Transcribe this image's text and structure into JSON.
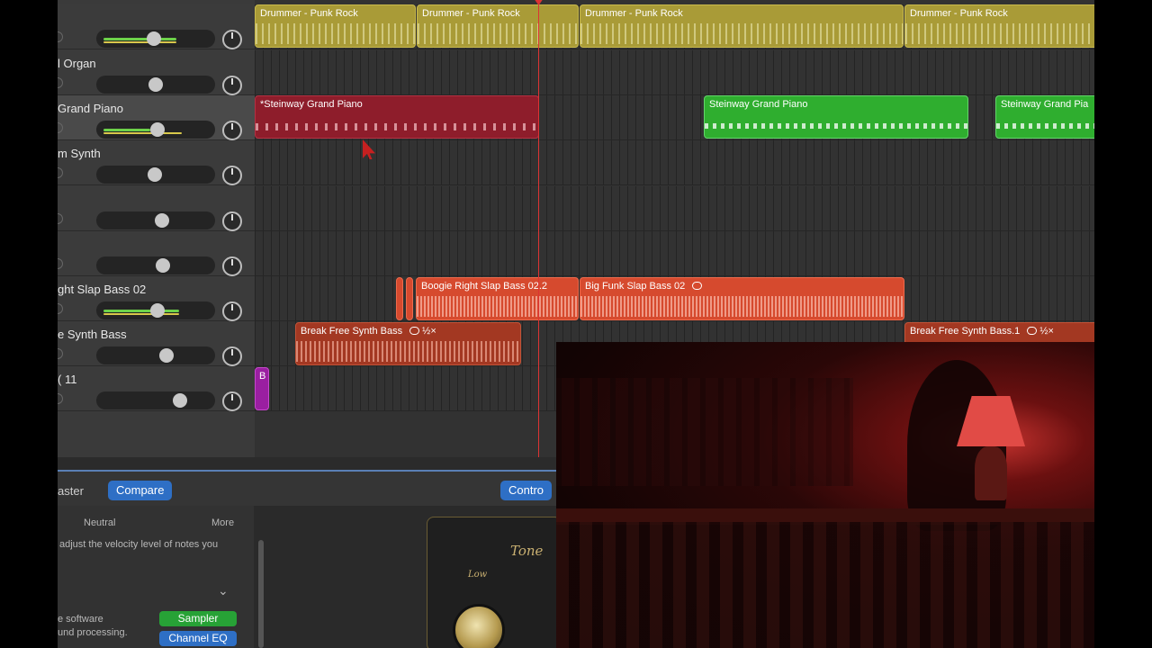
{
  "tracks": [
    {
      "name": "",
      "fader_level": 0.48,
      "meter": 0.7,
      "meter2": 0.7
    },
    {
      "name": "l Organ",
      "fader_level": 0.5,
      "meter": 0,
      "meter2": 0
    },
    {
      "name": "Grand Piano",
      "fader_level": 0.52,
      "meter": 0.45,
      "meter2": 0.75,
      "selected": true
    },
    {
      "name": "m Synth",
      "fader_level": 0.49,
      "meter": 0,
      "meter2": 0
    },
    {
      "name": "",
      "fader_level": 0.56,
      "meter": 0,
      "meter2": 0
    },
    {
      "name": "",
      "fader_level": 0.57,
      "meter": 0,
      "meter2": 0
    },
    {
      "name": "ght Slap Bass 02",
      "fader_level": 0.52,
      "meter": 0.72,
      "meter2": 0.72
    },
    {
      "name": "e Synth Bass",
      "fader_level": 0.6,
      "meter": 0,
      "meter2": 0
    },
    {
      "name": "( 11",
      "fader_level": 0.73,
      "meter": 0,
      "meter2": 0
    }
  ],
  "regions": {
    "drummer": [
      "Drummer - Punk Rock",
      "Drummer - Punk Rock",
      "Drummer - Punk Rock",
      "Drummer - Punk Rock"
    ],
    "piano_red": "*Steinway Grand Piano",
    "piano_green_1": "Steinway Grand Piano",
    "piano_green_2": "Steinway Grand Pia",
    "bass_1": "Boogie Right Slap Bass 02.2",
    "bass_2": "Big Funk Slap Bass 02",
    "synth_bass_1": "Break Free Synth Bass",
    "synth_bass_1_speed": "½×",
    "synth_bass_2": "Break Free Synth Bass.1",
    "synth_bass_2_speed": "½×",
    "purple_marker": "B"
  },
  "smart_controls": {
    "tab_left": "aster",
    "compare": "Compare",
    "controls": "Contro",
    "neutral": "Neutral",
    "more": "More",
    "velocity_desc": "adjust the velocity level of notes you",
    "software_desc_1": "e software",
    "software_desc_2": "und processing.",
    "sampler": "Sampler",
    "channel_eq": "Channel EQ",
    "tone_title": "Tone",
    "tone_low": "Low"
  },
  "colors": {
    "drummer": "#a99b37",
    "piano_red": "#8e1d2b",
    "piano_green": "#2fae2f",
    "bass": "#d64a2e",
    "accent_blue": "#2e6fc5",
    "playhead": "#d33333"
  },
  "icons": [
    "loop-icon",
    "chevron-down-icon",
    "pointer-cursor-icon"
  ]
}
